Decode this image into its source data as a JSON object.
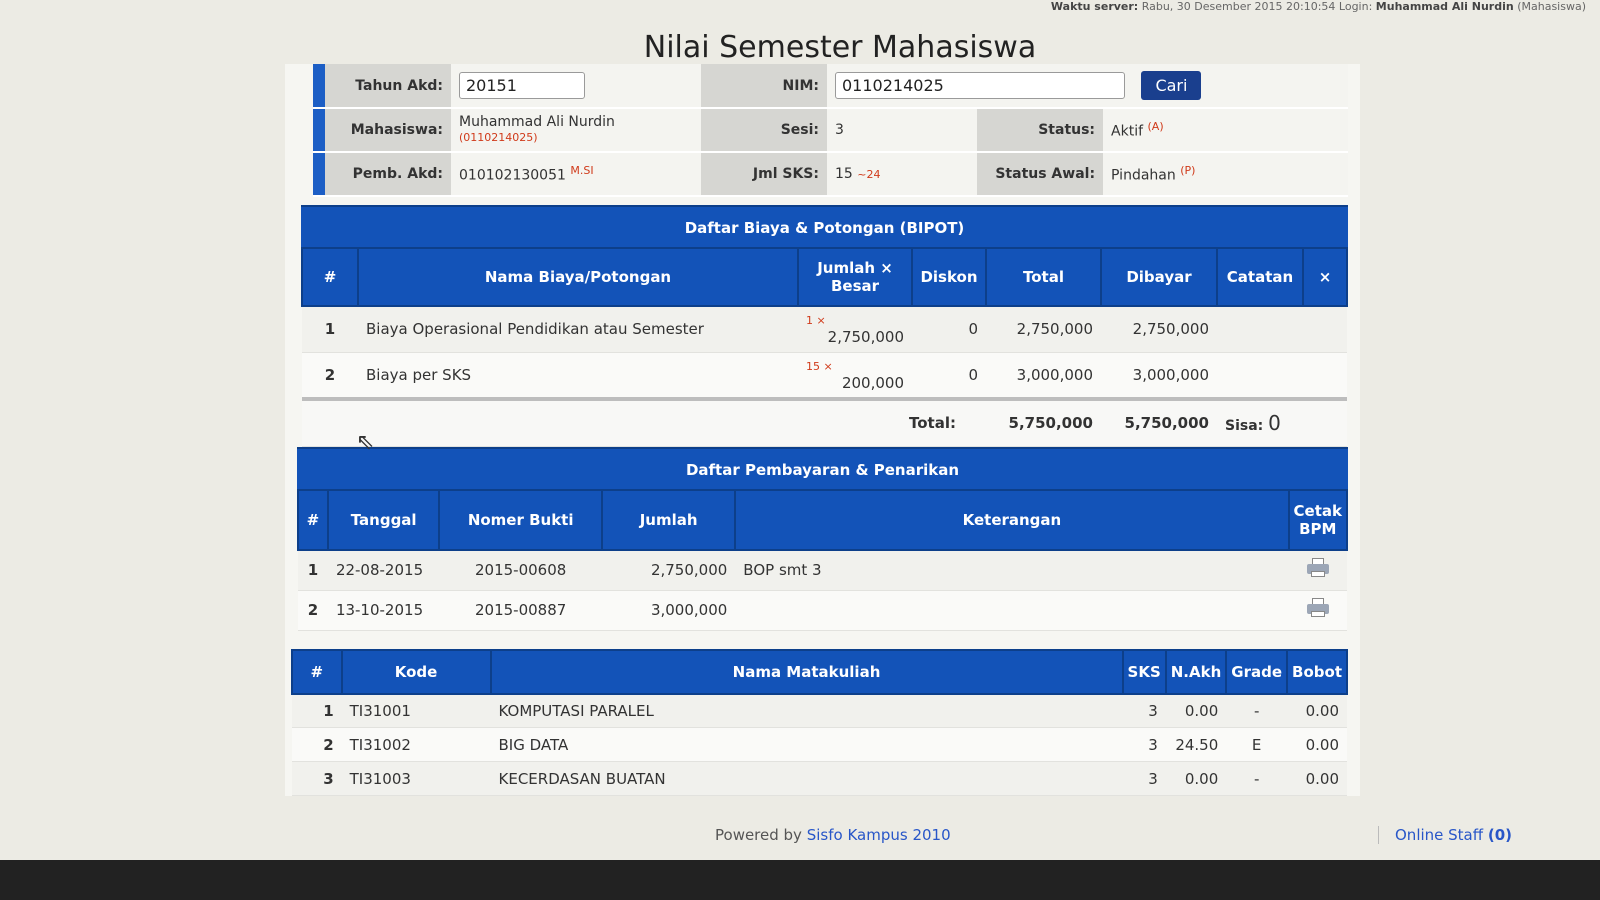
{
  "topbar": {
    "server_label": "Waktu server:",
    "server_time": "Rabu, 30 Desember 2015 20:10:54",
    "login_label": "Login:",
    "login_user": "Muhammad Ali Nurdin",
    "login_role": "(Mahasiswa)"
  },
  "page_title": "Nilai Semester Mahasiswa",
  "form": {
    "tahun_label": "Tahun Akd:",
    "tahun_value": "20151",
    "nim_label": "NIM:",
    "nim_value": "0110214025",
    "cari_label": "Cari"
  },
  "info": {
    "mahasiswa_label": "Mahasiswa:",
    "mahasiswa_name": "Muhammad Ali Nurdin",
    "mahasiswa_nim": "(0110214025)",
    "sesi_label": "Sesi:",
    "sesi_value": "3",
    "status_label": "Status:",
    "status_value": "Aktif",
    "status_code": "(A)",
    "pemb_label": "Pemb. Akd:",
    "pemb_value": "010102130051",
    "pemb_suffix": "M.SI",
    "jml_label": "Jml SKS:",
    "jml_value": "15",
    "jml_max": "~24",
    "status_awal_label": "Status Awal:",
    "status_awal_value": "Pindahan",
    "status_awal_code": "(P)"
  },
  "bipot": {
    "title": "Daftar Biaya & Potongan (BIPOT)",
    "headers": [
      "#",
      "Nama Biaya/Potongan",
      "Jumlah × Besar",
      "Diskon",
      "Total",
      "Dibayar",
      "Catatan",
      "×"
    ],
    "rows": [
      {
        "no": "1",
        "nama": "Biaya Operasional Pendidikan atau Semester",
        "jumlah": "1 ×",
        "besar": "2,750,000",
        "diskon": "0",
        "total": "2,750,000",
        "dibayar": "2,750,000",
        "catatan": ""
      },
      {
        "no": "2",
        "nama": "Biaya per SKS",
        "jumlah": "15 ×",
        "besar": "200,000",
        "diskon": "0",
        "total": "3,000,000",
        "dibayar": "3,000,000",
        "catatan": ""
      }
    ],
    "total_label": "Total:",
    "total_value": "5,750,000",
    "dibayar_value": "5,750,000",
    "sisa_label": "Sisa:",
    "sisa_value": "0"
  },
  "pembayaran": {
    "title": "Daftar Pembayaran & Penarikan",
    "headers": [
      "#",
      "Tanggal",
      "Nomer Bukti",
      "Jumlah",
      "Keterangan",
      "Cetak BPM"
    ],
    "rows": [
      {
        "no": "1",
        "tanggal": "22-08-2015",
        "bukti": "2015-00608",
        "jumlah": "2,750,000",
        "keterangan": "BOP smt 3"
      },
      {
        "no": "2",
        "tanggal": "13-10-2015",
        "bukti": "2015-00887",
        "jumlah": "3,000,000",
        "keterangan": ""
      }
    ]
  },
  "matakuliah": {
    "headers": [
      "#",
      "Kode",
      "Nama Matakuliah",
      "SKS",
      "N.Akh",
      "Grade",
      "Bobot"
    ],
    "rows": [
      {
        "no": "1",
        "kode": "TI31001",
        "nama": "KOMPUTASI PARALEL",
        "sks": "3",
        "nakh": "0.00",
        "grade": "-",
        "bobot": "0.00"
      },
      {
        "no": "2",
        "kode": "TI31002",
        "nama": "BIG DATA",
        "sks": "3",
        "nakh": "24.50",
        "grade": "E",
        "bobot": "0.00"
      },
      {
        "no": "3",
        "kode": "TI31003",
        "nama": "KECERDASAN BUATAN",
        "sks": "3",
        "nakh": "0.00",
        "grade": "-",
        "bobot": "0.00"
      }
    ]
  },
  "footer": {
    "powered_label": "Powered by",
    "powered_link": "Sisfo Kampus 2010",
    "online_staff": "Online Staff",
    "online_count": "(0)"
  }
}
